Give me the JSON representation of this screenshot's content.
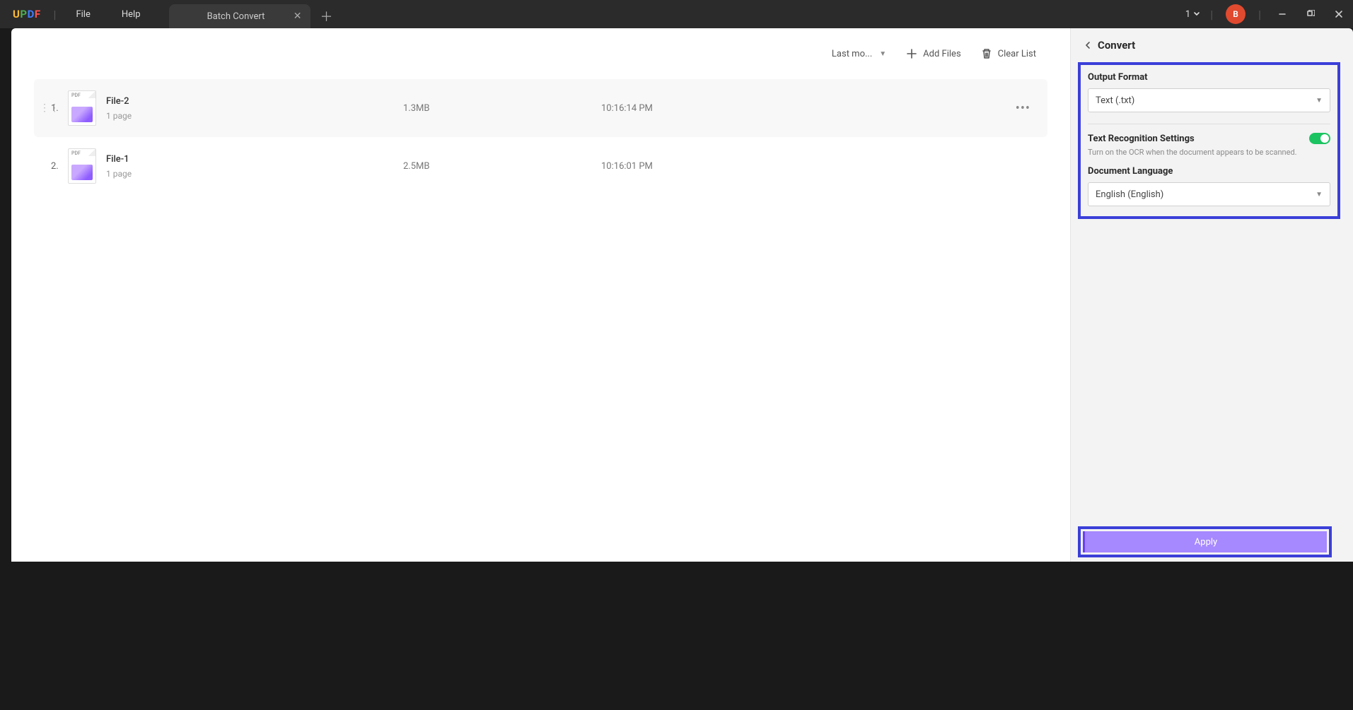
{
  "app": {
    "logo": "UPDF"
  },
  "menu": {
    "file": "File",
    "help": "Help"
  },
  "tab": {
    "title": "Batch Convert"
  },
  "window": {
    "count": "1",
    "avatar_initial": "B"
  },
  "toolbar": {
    "sort_label": "Last mo...",
    "add_files": "Add Files",
    "clear_list": "Clear List"
  },
  "files": [
    {
      "idx": "1.",
      "name": "File-2",
      "pages": "1 page",
      "size": "1.3MB",
      "time": "10:16:14 PM"
    },
    {
      "idx": "2.",
      "name": "File-1",
      "pages": "1 page",
      "size": "2.5MB",
      "time": "10:16:01 PM"
    }
  ],
  "panel": {
    "title": "Convert",
    "output_format_label": "Output Format",
    "output_format_value": "Text (.txt)",
    "ocr_label": "Text Recognition Settings",
    "ocr_hint": "Turn on the OCR when the document appears to be scanned.",
    "doc_lang_label": "Document Language",
    "doc_lang_value": "English (English)",
    "apply": "Apply"
  }
}
